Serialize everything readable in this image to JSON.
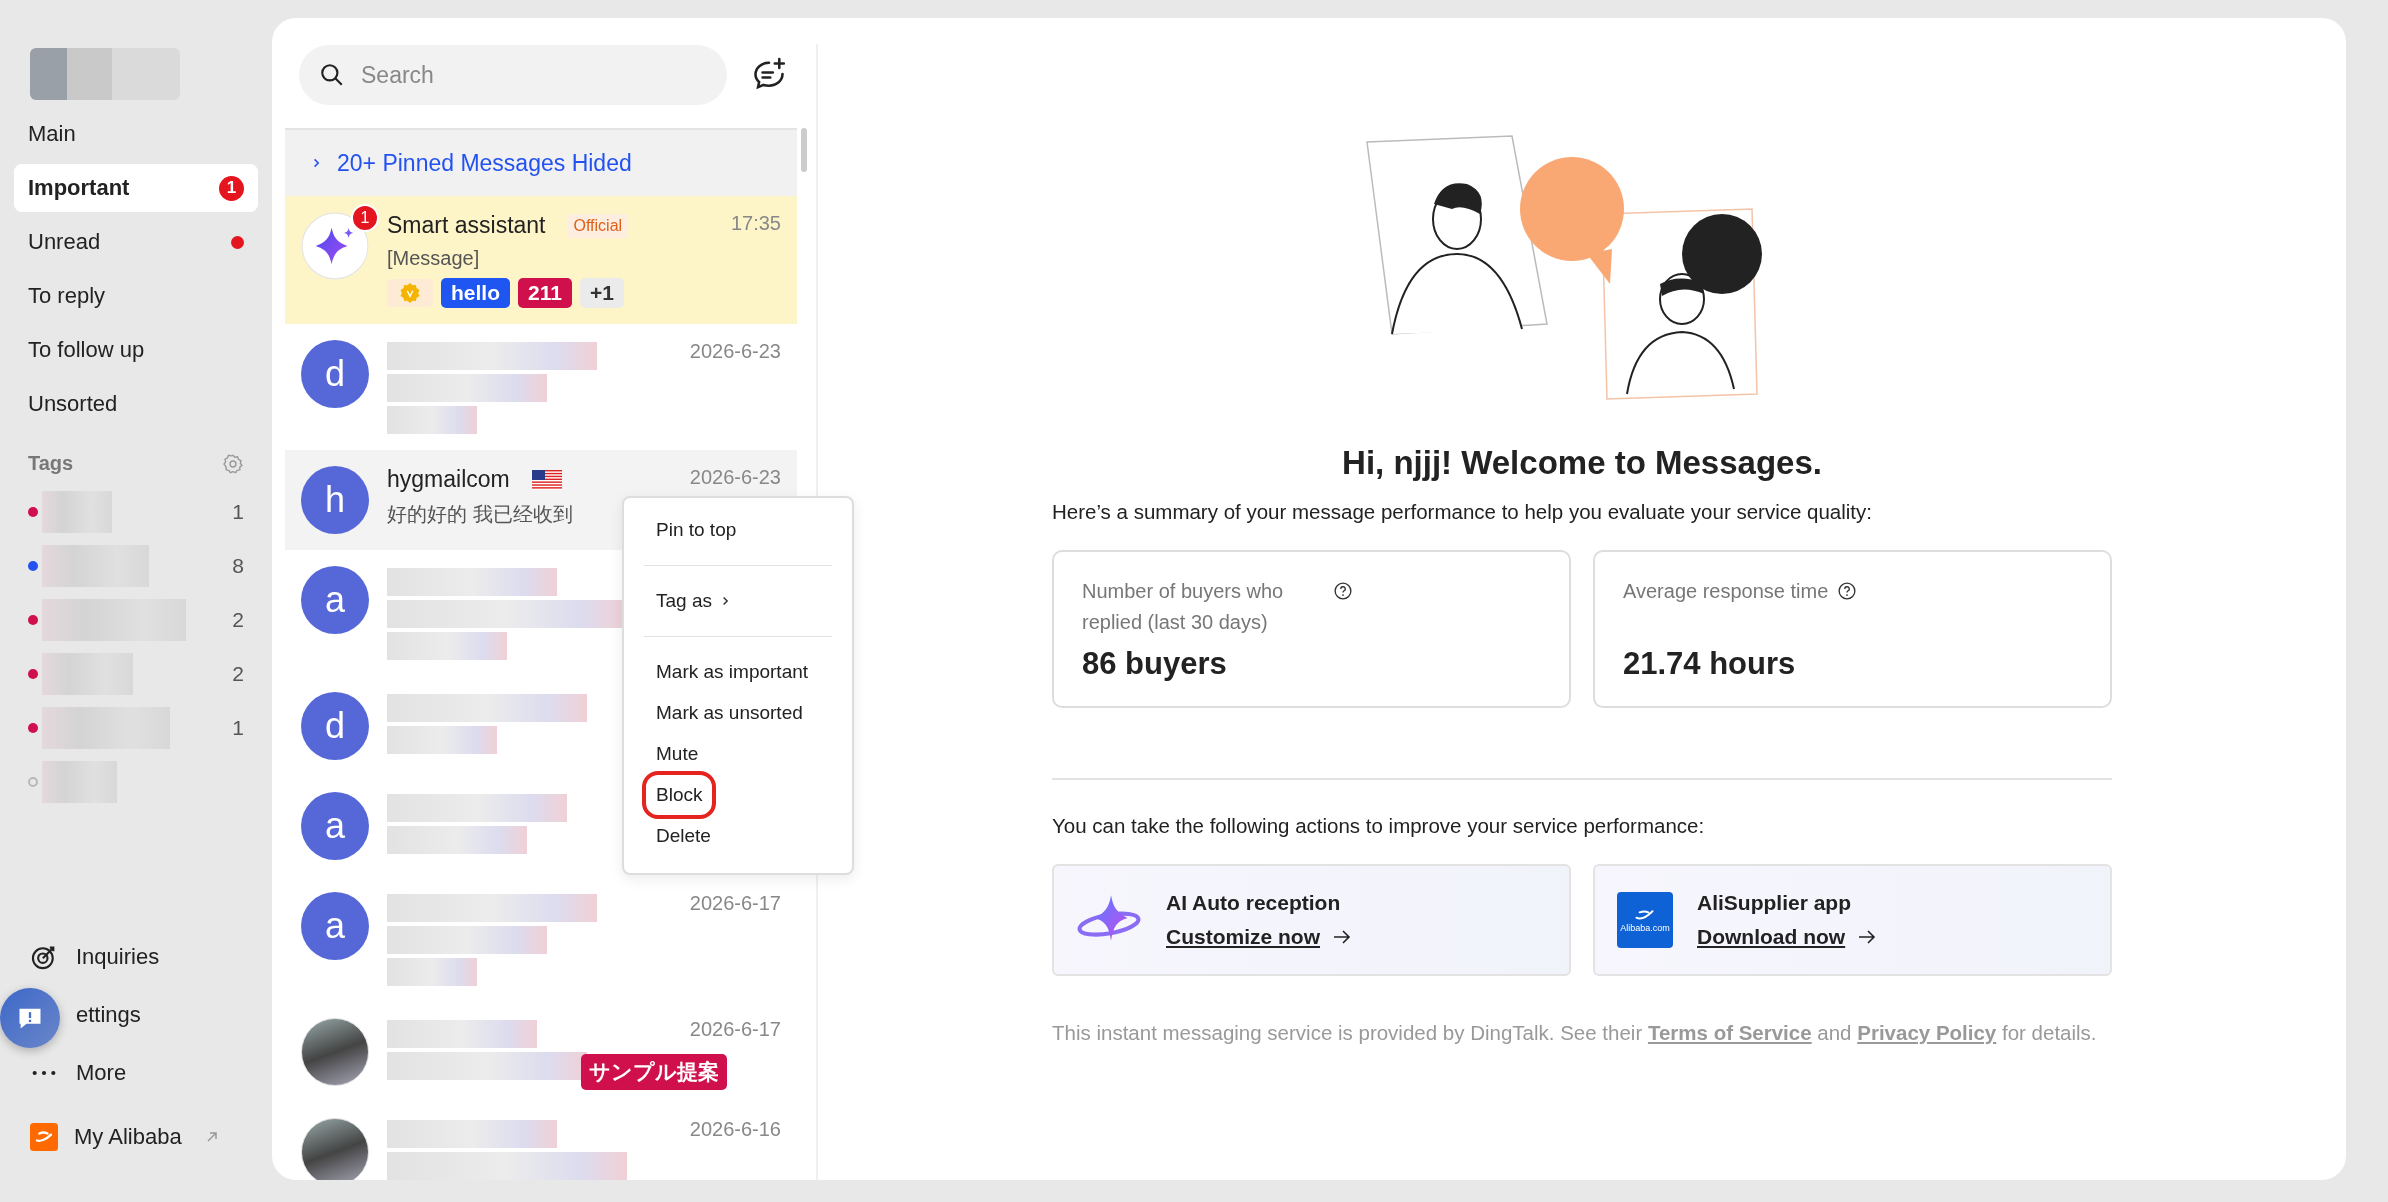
{
  "sidebar": {
    "nav": [
      {
        "label": "Main",
        "selected": false,
        "dot": false
      },
      {
        "label": "Important",
        "selected": true,
        "dot": false,
        "badge": "1"
      },
      {
        "label": "Unread",
        "selected": false,
        "dot": true
      },
      {
        "label": "To reply",
        "selected": false,
        "dot": false
      },
      {
        "label": "To follow up",
        "selected": false,
        "dot": false
      },
      {
        "label": "Unsorted",
        "selected": false,
        "dot": false
      }
    ],
    "tags_title": "Tags",
    "tags": [
      {
        "color": "#d0104c",
        "count": "1"
      },
      {
        "color": "#2352f0",
        "count": "8"
      },
      {
        "color": "#d0104c",
        "count": "2"
      },
      {
        "color": "#d0104c",
        "count": "2"
      },
      {
        "color": "#d0104c",
        "count": "1"
      },
      {
        "color": "#b8b8b8"
      }
    ],
    "bottom": [
      {
        "kind": "inquiries",
        "label": "Inquiries"
      },
      {
        "kind": "settings",
        "label": "ettings"
      },
      {
        "kind": "more",
        "label": "More"
      },
      {
        "kind": "alibaba",
        "label": "My Alibaba"
      }
    ]
  },
  "messages": {
    "search": {
      "placeholder": "Search"
    },
    "pinned": "20+ Pinned Messages Hided",
    "conversations": [
      {
        "kind": "plain",
        "avatar": {
          "kind": "star"
        },
        "name": "Smart assistant",
        "unread": "1",
        "label": "Official",
        "time": "17:35",
        "preview": "[Message]",
        "highlighted": true,
        "hovered": false,
        "tags": [
          {
            "kind": "icon"
          },
          {
            "kind": "text",
            "text": "hello",
            "color": "#1f55f0"
          },
          {
            "kind": "text",
            "text": "211",
            "color": "#d0104c"
          },
          {
            "kind": "more",
            "text": "+1"
          }
        ]
      },
      {
        "kind": "blurred",
        "avatar": {
          "kind": "letter",
          "letter": "d"
        },
        "time": "2026-6-23",
        "highlighted": false,
        "hovered": false
      },
      {
        "kind": "plain",
        "avatar": {
          "kind": "letter",
          "letter": "h"
        },
        "name": "hygmailcom",
        "flag": true,
        "time": "2026-6-23",
        "preview": "好的好的 我已经收到",
        "highlighted": false,
        "hovered": true
      },
      {
        "kind": "blurred",
        "avatar": {
          "kind": "letter",
          "letter": "a"
        },
        "highlighted": false,
        "hovered": false
      },
      {
        "kind": "blurred",
        "avatar": {
          "kind": "letter",
          "letter": "d"
        },
        "highlighted": false,
        "hovered": false
      },
      {
        "kind": "blurred",
        "avatar": {
          "kind": "letter",
          "letter": "a"
        },
        "highlighted": false,
        "hovered": false
      },
      {
        "kind": "blurred",
        "avatar": {
          "kind": "letter",
          "letter": "a"
        },
        "time": "2026-6-17",
        "highlighted": false,
        "hovered": false
      },
      {
        "kind": "blurred",
        "avatar": {
          "kind": "photo"
        },
        "time": "2026-6-17",
        "label_tag": "サンプル提案",
        "highlighted": false,
        "hovered": false
      },
      {
        "kind": "blurred",
        "avatar": {
          "kind": "photo"
        },
        "time": "2026-6-16",
        "highlighted": false,
        "hovered": false
      }
    ]
  },
  "context_menu": {
    "groups": [
      [
        {
          "label": "Pin to top",
          "submenu": false,
          "circled": false
        }
      ],
      [
        {
          "label": "Tag as",
          "submenu": true,
          "circled": false
        }
      ],
      [
        {
          "label": "Mark as important",
          "submenu": false,
          "circled": false
        },
        {
          "label": "Mark as unsorted",
          "submenu": false,
          "circled": false
        },
        {
          "label": "Mute",
          "submenu": false,
          "circled": false
        },
        {
          "label": "Block",
          "submenu": false,
          "circled": true
        },
        {
          "label": "Delete",
          "submenu": false,
          "circled": false
        }
      ]
    ]
  },
  "welcome": {
    "title": "Hi, njjj! Welcome to Messages.",
    "summary": "Here’s a summary of your message performance to help you evaluate your service quality:",
    "stats": [
      {
        "label": "Number of buyers who replied (last 30 days)",
        "value": "86 buyers"
      },
      {
        "label": "Average response time",
        "value": "21.74 hours"
      }
    ],
    "actions_intro": "You can take the following actions to improve your service performance:",
    "actions": [
      {
        "kind": "ai",
        "title": "AI Auto reception",
        "link": "Customize now"
      },
      {
        "kind": "app",
        "title": "AliSupplier app",
        "link": "Download now",
        "logo_text": "Alibaba.com"
      }
    ],
    "footer": [
      {
        "text": "This instant messaging service is provided by DingTalk. See their ",
        "link": false
      },
      {
        "text": "Terms of Service",
        "link": true
      },
      {
        "text": " and ",
        "link": false
      },
      {
        "text": "Privacy Policy",
        "link": true
      },
      {
        "text": " for details.",
        "link": false
      }
    ]
  }
}
